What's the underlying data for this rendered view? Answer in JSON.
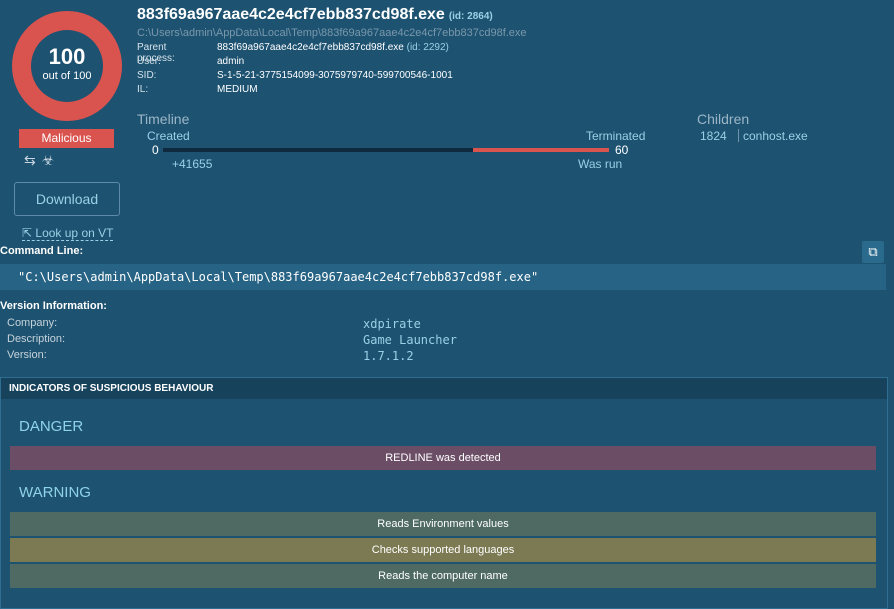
{
  "score": {
    "value": "100",
    "out_of": "out of 100",
    "verdict": "Malicious"
  },
  "actions": {
    "download": "Download",
    "lookup_vt": "Look up on VT"
  },
  "process": {
    "name": "883f69a967aae4c2e4cf7ebb837cd98f.exe",
    "id": "(id: 2864)",
    "path": "C:\\Users\\admin\\AppData\\Local\\Temp\\883f69a967aae4c2e4cf7ebb837cd98f.exe",
    "details": [
      {
        "key": "Parent process:",
        "value": "883f69a967aae4c2e4cf7ebb837cd98f.exe",
        "extra": "(id: 2292)"
      },
      {
        "key": "User:",
        "value": "admin",
        "extra": ""
      },
      {
        "key": "SID:",
        "value": "S-1-5-21-3775154099-3075979740-599700546-1001",
        "extra": ""
      },
      {
        "key": "IL:",
        "value": "MEDIUM",
        "extra": ""
      }
    ]
  },
  "timeline": {
    "title": "Timeline",
    "created_label": "Created",
    "terminated_label": "Terminated",
    "start": "0",
    "end": "60",
    "offset": "+41655",
    "was_run": "Was run"
  },
  "children": {
    "title": "Children",
    "items": [
      {
        "pid": "1824",
        "name": "conhost.exe"
      }
    ]
  },
  "command_line": {
    "label": "Command Line:",
    "value": "\"C:\\Users\\admin\\AppData\\Local\\Temp\\883f69a967aae4c2e4cf7ebb837cd98f.exe\""
  },
  "version_info": {
    "label": "Version Information:",
    "rows": [
      {
        "key": "Company:",
        "value": "xdpirate"
      },
      {
        "key": "Description:",
        "value": "Game Launcher"
      },
      {
        "key": "Version:",
        "value": "1.7.1.2"
      }
    ]
  },
  "indicators": {
    "title": "INDICATORS OF SUSPICIOUS BEHAVIOUR",
    "danger_label": "DANGER",
    "danger": [
      "REDLINE was detected"
    ],
    "warning_label": "WARNING",
    "warning": [
      "Reads Environment values",
      "Checks supported languages",
      "Reads the computer name"
    ]
  },
  "colors": {
    "background": "#1d5271",
    "malicious": "#d9534f",
    "danger_row": "#6b4e66",
    "warning_row_a": "#4f6a63",
    "warning_row_b": "#7b7a52",
    "accent_text": "#9bd0e6"
  }
}
